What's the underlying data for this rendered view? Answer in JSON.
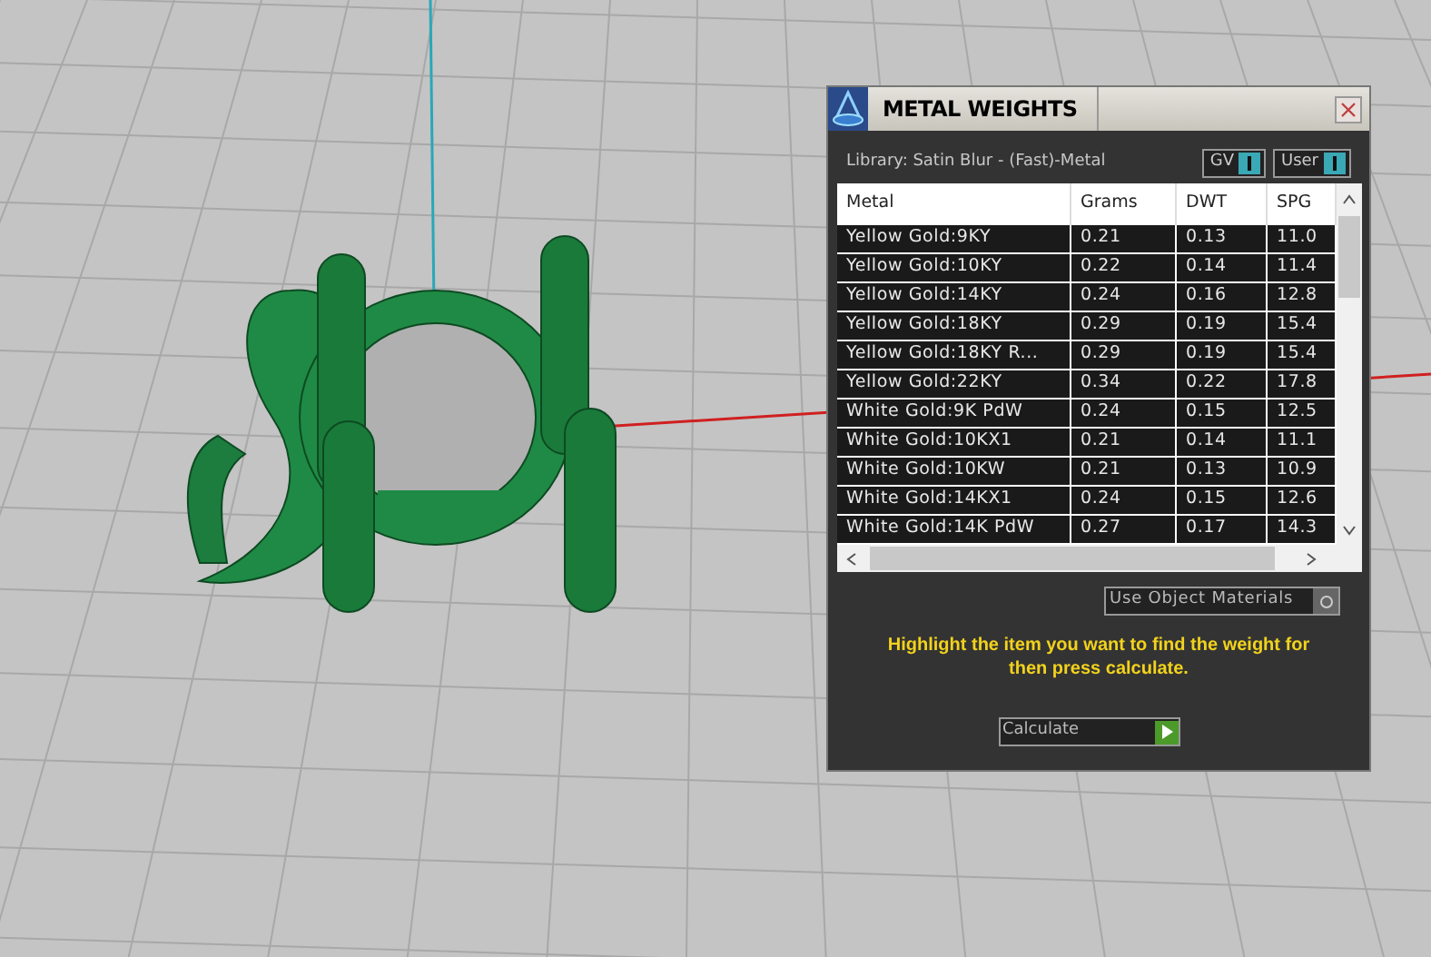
{
  "window": {
    "title": "METAL WEIGHTS",
    "library": "Library: Satin Blur - (Fast)-Metal"
  },
  "toggles": [
    {
      "label": "GV"
    },
    {
      "label": "User"
    }
  ],
  "table": {
    "columns": [
      "Metal",
      "Grams",
      "DWT",
      "SPG"
    ],
    "rows": [
      [
        "Yellow Gold:9KY",
        "0.21",
        "0.13",
        "11.0"
      ],
      [
        "Yellow Gold:10KY",
        "0.22",
        "0.14",
        "11.4"
      ],
      [
        "Yellow Gold:14KY",
        "0.24",
        "0.16",
        "12.8"
      ],
      [
        "Yellow Gold:18KY",
        "0.29",
        "0.19",
        "15.4"
      ],
      [
        "Yellow Gold:18KY R...",
        "0.29",
        "0.19",
        "15.4"
      ],
      [
        "Yellow Gold:22KY",
        "0.34",
        "0.22",
        "17.8"
      ],
      [
        "White Gold:9K PdW",
        "0.24",
        "0.15",
        "12.5"
      ],
      [
        "White Gold:10KX1",
        "0.21",
        "0.14",
        "11.1"
      ],
      [
        "White Gold:10KW",
        "0.21",
        "0.13",
        "10.9"
      ],
      [
        "White Gold:14KX1",
        "0.24",
        "0.15",
        "12.6"
      ],
      [
        "White Gold:14K PdW",
        "0.27",
        "0.17",
        "14.3"
      ]
    ]
  },
  "material_select": {
    "value": "Use Object Materials"
  },
  "message": "Highlight the item you want to find the weight for then press calculate.",
  "calculate": {
    "value": "Calculate"
  }
}
